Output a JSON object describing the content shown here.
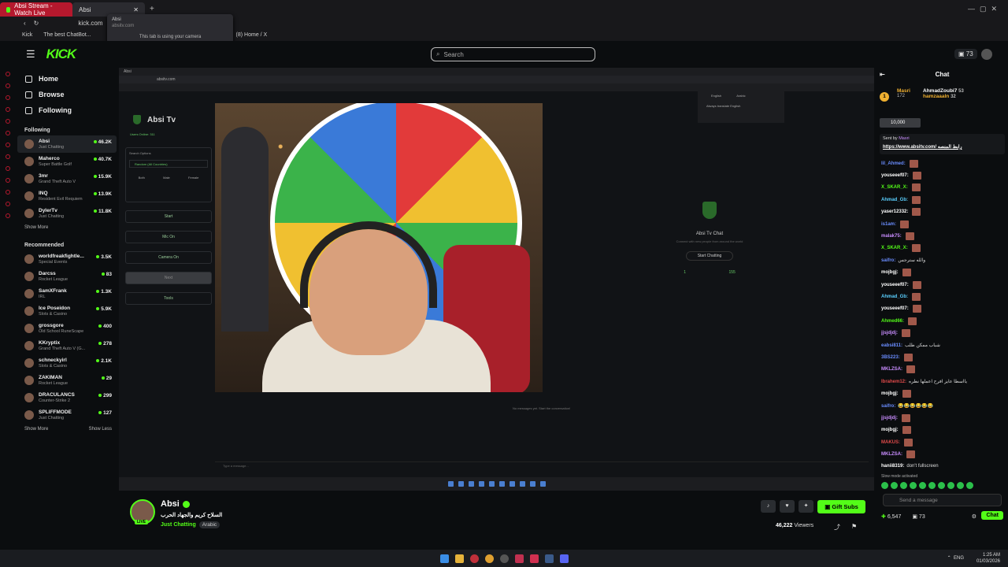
{
  "browser": {
    "tabs": [
      {
        "label": "Absi Stream - Watch Live"
      },
      {
        "label": "Absi"
      }
    ],
    "url": "kick.com",
    "tooltip": {
      "title": "Absi",
      "host": "absitv.com",
      "note": "This tab is using your camera"
    },
    "bookmarks": [
      "Kick",
      "The best ChatBot...",
      "(8) Home / X"
    ]
  },
  "header": {
    "logo": "KICK",
    "search_placeholder": "Search",
    "coins": "73"
  },
  "nav": [
    {
      "label": "Home",
      "icon": "home-icon"
    },
    {
      "label": "Browse",
      "icon": "browse-icon"
    },
    {
      "label": "Following",
      "icon": "heart-icon"
    }
  ],
  "following": {
    "heading": "Following",
    "channels": [
      {
        "name": "Absi",
        "game": "Just Chatting",
        "viewers": "46.2K"
      },
      {
        "name": "Maherco",
        "game": "Super Battle Golf",
        "viewers": "40.7K"
      },
      {
        "name": "3mr",
        "game": "Grand Theft Auto V",
        "viewers": "15.9K"
      },
      {
        "name": "INQ",
        "game": "Resident Evil Requiem",
        "viewers": "13.9K"
      },
      {
        "name": "DylerTv",
        "game": "Just Chatting",
        "viewers": "11.8K"
      }
    ],
    "show_more": "Show More"
  },
  "recommended": {
    "heading": "Recommended",
    "channels": [
      {
        "name": "worldfreakfightle...",
        "game": "Special Events",
        "viewers": "3.5K"
      },
      {
        "name": "Darcss",
        "game": "Rocket League",
        "viewers": "83"
      },
      {
        "name": "SamXFrank",
        "game": "IRL",
        "viewers": "1.3K"
      },
      {
        "name": "Ice Poseidon",
        "game": "Slots & Casino",
        "viewers": "5.9K"
      },
      {
        "name": "grossgore",
        "game": "Old School RuneScape",
        "viewers": "400"
      },
      {
        "name": "KKryptix",
        "game": "Grand Theft Auto V (G...",
        "viewers": "278"
      },
      {
        "name": "schneckyirl",
        "game": "Slots & Casino",
        "viewers": "2.1K"
      },
      {
        "name": "ZAKIMAN",
        "game": "Rocket League",
        "viewers": "29"
      },
      {
        "name": "DRACULANCS",
        "game": "Counter-Strike 2",
        "viewers": "299"
      },
      {
        "name": "SPLIFFMODE",
        "game": "Just Chatting",
        "viewers": "127"
      }
    ],
    "show_more": "Show More",
    "show_less": "Show Less"
  },
  "stream_app": {
    "url": "absitv.com",
    "title": "Absi Tv",
    "users_online": "Users Online: 311",
    "search_options": "Search Options",
    "country": "Random (All Countries)",
    "genders": [
      "Both",
      "Male",
      "Female"
    ],
    "buttons": [
      "Start",
      "Mic On",
      "Camera On",
      "Next",
      "Tools"
    ],
    "chat_title": "Absi Tv Chat",
    "chat_sub": "Connect with new people from around the world",
    "start_chatting": "Start Chatting",
    "stats": [
      "1",
      "155"
    ],
    "no_messages": "No messages yet. Start the conversation!",
    "type_placeholder": "Type a message...",
    "lang_tabs": [
      "English",
      "Arabic"
    ],
    "lang_option": "Always translate English"
  },
  "channel": {
    "name": "Absi",
    "live": "LIVE",
    "title": "السلاح كريم والجهاد الحرب",
    "category": "Just Chatting",
    "tag": "Arabic",
    "viewers": "46,222",
    "viewers_label": "Viewers",
    "gift_label": "Gift Subs"
  },
  "chat": {
    "title": "Chat",
    "pinned": [
      {
        "rank": "1",
        "name": "Masri",
        "value": "172"
      },
      {
        "name": "AhmadZoubi7",
        "value": "53"
      },
      {
        "name": "hamzaaaln",
        "value": "32"
      }
    ],
    "goal": "10,000",
    "pinned_msg": {
      "sent_by": "Sent by",
      "user": "Masri",
      "link": "https://www.absitv.com/ رابط المنصه"
    },
    "messages": [
      {
        "user": "lil_Ahmed",
        "color": "#6a8dff",
        "text": ""
      },
      {
        "user": "youseeef07",
        "color": "#ffffff",
        "text": ""
      },
      {
        "user": "X_SKAR_X",
        "color": "#53fc18",
        "text": ""
      },
      {
        "user": "Ahmad_Gb",
        "color": "#5ad0ff",
        "text": ""
      },
      {
        "user": "yaser12332",
        "color": "#ffffff",
        "text": ""
      },
      {
        "user": "is1am",
        "color": "#6a8dff",
        "text": ""
      },
      {
        "user": "malak75",
        "color": "#c98dff",
        "text": ""
      },
      {
        "user": "X_SKAR_X",
        "color": "#53fc18",
        "text": ""
      },
      {
        "user": "saifro",
        "color": "#6a8dff",
        "text": "والله سترجس"
      },
      {
        "user": "mojbgj",
        "color": "#ffffff",
        "text": ""
      },
      {
        "user": "youseeef07",
        "color": "#ffffff",
        "text": ""
      },
      {
        "user": "Ahmad_Gb",
        "color": "#5ad0ff",
        "text": ""
      },
      {
        "user": "youseeef07",
        "color": "#ffffff",
        "text": ""
      },
      {
        "user": "Ahmed66",
        "color": "#53fc18",
        "text": ""
      },
      {
        "user": "jjsjdjdj",
        "color": "#c98dff",
        "text": ""
      },
      {
        "user": "eabsi811",
        "color": "#6a8dff",
        "text": "شباب ممكن طلب"
      },
      {
        "user": "3BS223",
        "color": "#6a8dff",
        "text": ""
      },
      {
        "user": "MKLZSA",
        "color": "#c98dff",
        "text": ""
      },
      {
        "user": "Ibrahem12",
        "color": "#e04a4a",
        "text": "يااسطا عايز افرح اعملها نطره"
      },
      {
        "user": "mojbgj",
        "color": "#ffffff",
        "text": ""
      },
      {
        "user": "saifro",
        "color": "#6a8dff",
        "text": "😂😂😂😂😂😂"
      },
      {
        "user": "jjsjdjdj",
        "color": "#c98dff",
        "text": ""
      },
      {
        "user": "mojbgj",
        "color": "#ffffff",
        "text": ""
      },
      {
        "user": "MAKUS",
        "color": "#e04a4a",
        "text": ""
      },
      {
        "user": "MKLZSA",
        "color": "#c98dff",
        "text": ""
      },
      {
        "user": "hanii8319",
        "color": "#ffffff",
        "text": "don't fullscreen"
      }
    ],
    "slow_mode": "Slow mode activated",
    "send_placeholder": "Send a message",
    "points": "6,547",
    "count": "73",
    "chat_button": "Chat"
  },
  "system": {
    "lang": "ENG",
    "time": "1:25 AM",
    "date": "01/03/2026"
  }
}
